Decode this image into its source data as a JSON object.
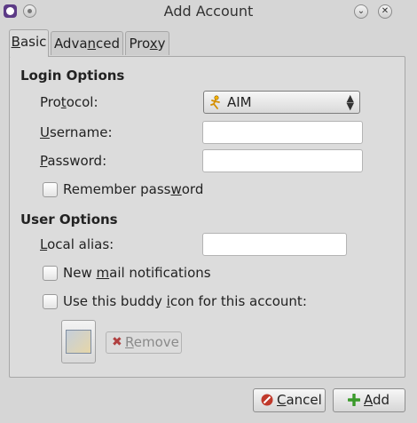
{
  "window": {
    "title": "Add Account"
  },
  "tabs": [
    {
      "label_pre": "",
      "label_u": "B",
      "label_post": "asic"
    },
    {
      "label_pre": "Adva",
      "label_u": "n",
      "label_post": "ced"
    },
    {
      "label_pre": "Pro",
      "label_u": "x",
      "label_post": "y"
    }
  ],
  "login": {
    "heading": "Login Options",
    "protocol": {
      "pre": "Pro",
      "u": "t",
      "post": "ocol:"
    },
    "protocol_value": "AIM",
    "username": {
      "pre": "",
      "u": "U",
      "post": "sername:"
    },
    "username_value": "",
    "password": {
      "pre": "",
      "u": "P",
      "post": "assword:"
    },
    "password_value": "",
    "remember": {
      "pre": "Remember pass",
      "u": "w",
      "post": "ord"
    }
  },
  "user": {
    "heading": "User Options",
    "alias": {
      "pre": "",
      "u": "L",
      "post": "ocal alias:"
    },
    "alias_value": "",
    "mail": {
      "pre": "New ",
      "u": "m",
      "post": "ail notifications"
    },
    "buddy": {
      "pre": "Use this buddy ",
      "u": "i",
      "post": "con for this account:"
    },
    "remove": {
      "pre": "",
      "u": "R",
      "post": "emove"
    }
  },
  "buttons": {
    "cancel": {
      "pre": "",
      "u": "C",
      "post": "ancel"
    },
    "add": {
      "pre": "",
      "u": "A",
      "post": "dd"
    }
  },
  "colors": {
    "cancel_icon": "#c0392b",
    "add_icon": "#3a9a2a",
    "app_icon": "#5c3b86"
  }
}
